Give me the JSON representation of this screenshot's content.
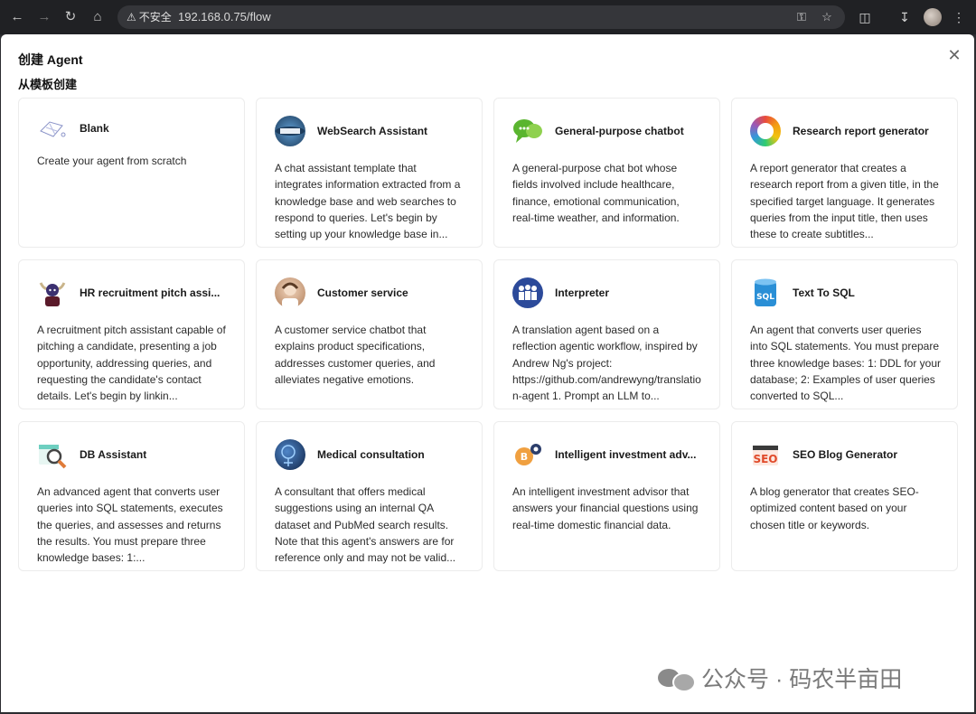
{
  "browser": {
    "security_label": "不安全",
    "url": "192.168.0.75/flow"
  },
  "dialog": {
    "title": "创建 Agent",
    "subtitle": "从模板创建"
  },
  "templates": [
    {
      "title": "Blank",
      "description": "Create your agent from scratch",
      "icon": "blank-icon",
      "color": "#e9ecf7"
    },
    {
      "title": "WebSearch Assistant",
      "description": "A chat assistant template that integrates information extracted from a knowledge base and web searches to respond to queries. Let's begin by setting up your knowledge base in...",
      "icon": "globe-icon",
      "color": "#2f5f8a"
    },
    {
      "title": "General-purpose chatbot",
      "description": "A general-purpose chat bot whose fields involved include healthcare, finance, emotional communication, real-time weather, and information.",
      "icon": "chat-bubbles-icon",
      "color": "#5ab52f"
    },
    {
      "title": "Research report generator",
      "description": "A report generator that creates a research report from a given title, in the specified target language. It generates queries from the input title, then uses these to create subtitles...",
      "icon": "color-wheel-icon",
      "color": "#f2f2f2"
    },
    {
      "title": "HR recruitment pitch assi...",
      "description": "A recruitment pitch assistant capable of pitching a candidate, presenting a job opportunity, addressing queries, and requesting the candidate's contact details. Let's begin by linkin...",
      "icon": "viking-avatar-icon",
      "color": "#3b3070"
    },
    {
      "title": "Customer service",
      "description": "A customer service chatbot that explains product specifications, addresses customer queries, and alleviates negative emotions.",
      "icon": "agent-avatar-icon",
      "color": "#d9b99a"
    },
    {
      "title": "Interpreter",
      "description": "A translation agent based on a reflection agentic workflow, inspired by Andrew Ng's project: https://github.com/andrewyng/translation-agent 1. Prompt an LLM to...",
      "icon": "people-icon",
      "color": "#2c4a9a"
    },
    {
      "title": "Text To SQL",
      "description": "An agent that converts user queries into SQL statements. You must prepare three knowledge bases: 1: DDL for your database; 2: Examples of user queries converted to SQL...",
      "icon": "sql-database-icon",
      "color": "#2a8fd6"
    },
    {
      "title": "DB Assistant",
      "description": "An advanced agent that converts user queries into SQL statements, executes the queries, and assesses and returns the results. You must prepare three knowledge bases: 1:...",
      "icon": "magnifier-icon",
      "color": "#6ecfc0"
    },
    {
      "title": "Medical consultation",
      "description": "A consultant that offers medical suggestions using an internal QA dataset and PubMed search results. Note that this agent's answers are for reference only and may not be valid...",
      "icon": "medical-icon",
      "color": "#1f3f7a"
    },
    {
      "title": "Intelligent investment adv...",
      "description": "An intelligent investment advisor that answers your financial questions using real-time domestic financial data.",
      "icon": "bitcoin-icon",
      "color": "#f0a040"
    },
    {
      "title": "SEO Blog Generator",
      "description": "A blog generator that creates SEO-optimized content based on your chosen title or keywords.",
      "icon": "seo-icon",
      "color": "#e04a2a"
    }
  ],
  "watermark": "公众号 · 码农半亩田"
}
